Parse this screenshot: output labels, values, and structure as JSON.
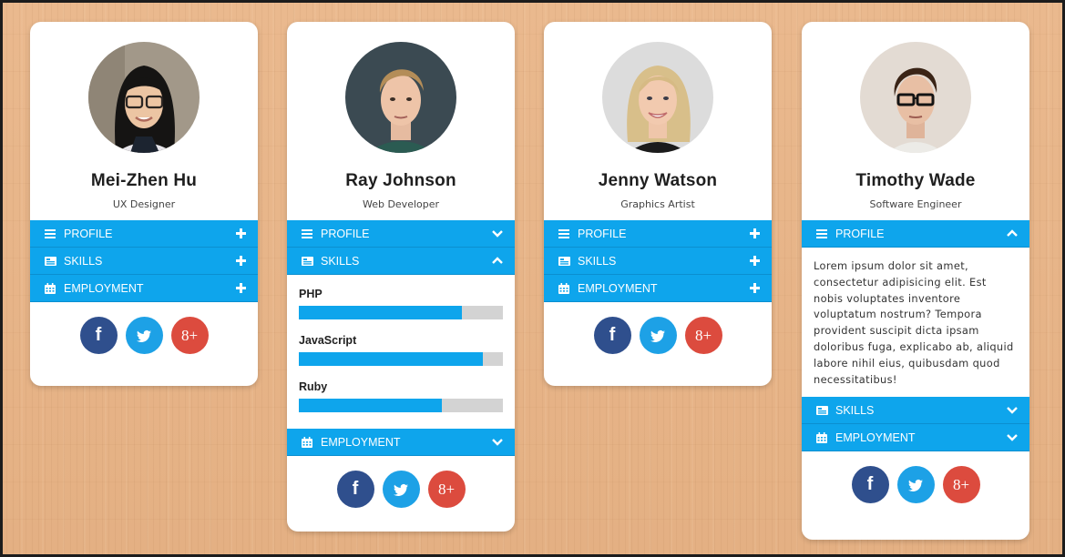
{
  "colors": {
    "accent": "#0ea5ec",
    "facebook": "#2f4f8d",
    "twitter": "#1da1e6",
    "googleplus": "#dc4b3e",
    "background": "#e8b589"
  },
  "icons": {
    "profile": "list-icon",
    "skills": "id-card-icon",
    "employment": "calendar-icon",
    "collapsed": "plus-icon",
    "chevron_down": "chevron-down-icon",
    "chevron_up": "chevron-up-icon"
  },
  "social": {
    "facebook_glyph": "f",
    "twitter_glyph": "twitter-bird-icon",
    "googleplus_glyph": "8+"
  },
  "cards": [
    {
      "name": "Mei-Zhen Hu",
      "role": "UX Designer",
      "sections": {
        "profile": {
          "label": "PROFILE",
          "state": "collapsed-plus"
        },
        "skills": {
          "label": "SKILLS",
          "state": "collapsed-plus"
        },
        "employment": {
          "label": "EMPLOYMENT",
          "state": "collapsed-plus"
        }
      }
    },
    {
      "name": "Ray Johnson",
      "role": "Web Developer",
      "sections": {
        "profile": {
          "label": "PROFILE",
          "state": "collapsed-chevron"
        },
        "skills": {
          "label": "SKILLS",
          "state": "expanded"
        },
        "employment": {
          "label": "EMPLOYMENT",
          "state": "collapsed-chevron"
        }
      },
      "skills": [
        {
          "name": "PHP",
          "level": 0.8
        },
        {
          "name": "JavaScript",
          "level": 0.9
        },
        {
          "name": "Ruby",
          "level": 0.7
        }
      ]
    },
    {
      "name": "Jenny Watson",
      "role": "Graphics Artist",
      "sections": {
        "profile": {
          "label": "PROFILE",
          "state": "collapsed-plus"
        },
        "skills": {
          "label": "SKILLS",
          "state": "collapsed-plus"
        },
        "employment": {
          "label": "EMPLOYMENT",
          "state": "collapsed-plus"
        }
      }
    },
    {
      "name": "Timothy Wade",
      "role": "Software Engineer",
      "sections": {
        "profile": {
          "label": "PROFILE",
          "state": "expanded"
        },
        "skills": {
          "label": "SKILLS",
          "state": "collapsed-chevron"
        },
        "employment": {
          "label": "EMPLOYMENT",
          "state": "collapsed-chevron"
        }
      },
      "profile_text": "Lorem ipsum dolor sit amet, consectetur adipisicing elit. Est nobis voluptates inventore voluptatum nostrum? Tempora provident suscipit dicta ipsam doloribus fuga, explicabo ab, aliquid labore nihil eius, quibusdam quod necessitatibus!"
    }
  ]
}
